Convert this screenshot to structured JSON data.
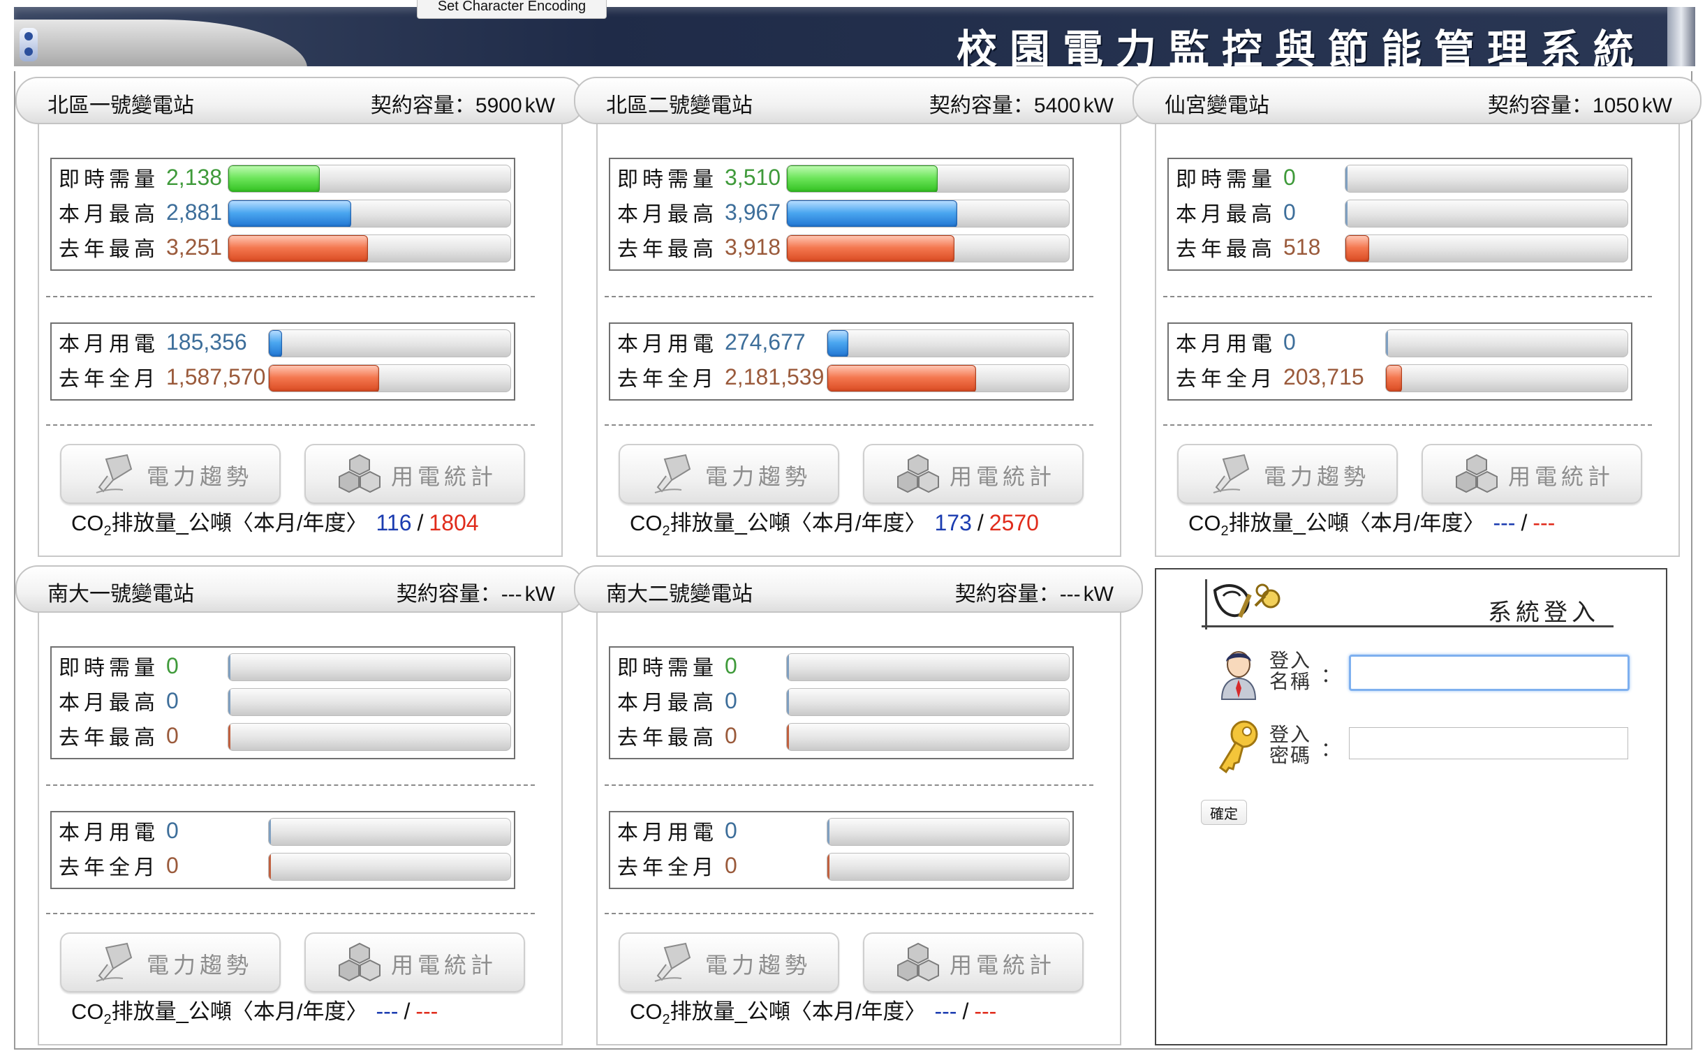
{
  "header": {
    "title": "校園電力監控與節能管理系統",
    "encoding_menu": "Set Character Encoding"
  },
  "labels": {
    "demand_now": "即時需量",
    "month_max": "本月最高",
    "last_year_max": "去年最高",
    "month_usage": "本月用電",
    "last_year_month": "去年全月",
    "capacity_prefix": "契約容量：",
    "capacity_unit": "kW",
    "trend_button": "電力趨勢",
    "stats_button": "用電統計",
    "co2_pre": "CO",
    "co2_sub": "2",
    "co2_post": "排放量_公噸〈本月/年度〉",
    "slash": "/"
  },
  "colors": {
    "demand_now": "#6de55b",
    "month_max": "#4aa6f0",
    "last_year": "#f4774f",
    "co2_month": "#1b3cb0",
    "co2_year": "#e02b1b"
  },
  "stations": [
    {
      "name": "北區一號變電站",
      "capacity": "5900",
      "demand_now": "2,138",
      "month_max": "2,881",
      "last_year_max": "3,251",
      "demand_levels": [
        0.32,
        0.43,
        0.49
      ],
      "month_usage": "185,356",
      "last_year_month": "1,587,570",
      "usage_levels": [
        0.05,
        0.45
      ],
      "co2_month": "116",
      "co2_year": "1804"
    },
    {
      "name": "北區二號變電站",
      "capacity": "5400",
      "demand_now": "3,510",
      "month_max": "3,967",
      "last_year_max": "3,918",
      "demand_levels": [
        0.53,
        0.6,
        0.59
      ],
      "month_usage": "274,677",
      "last_year_month": "2,181,539",
      "usage_levels": [
        0.08,
        0.61
      ],
      "co2_month": "173",
      "co2_year": "2570"
    },
    {
      "name": "仙宮變電站",
      "capacity": "1050",
      "demand_now": "0",
      "month_max": "0",
      "last_year_max": "518",
      "demand_levels": [
        0,
        0,
        0.08
      ],
      "month_usage": "0",
      "last_year_month": "203,715",
      "usage_levels": [
        0,
        0.06
      ],
      "co2_month": "---",
      "co2_year": "---"
    },
    {
      "name": "南大一號變電站",
      "capacity": "---",
      "demand_now": "0",
      "month_max": "0",
      "last_year_max": "0",
      "demand_levels": [
        0,
        0,
        0
      ],
      "month_usage": "0",
      "last_year_month": "0",
      "usage_levels": [
        0,
        0
      ],
      "co2_month": "---",
      "co2_year": "---"
    },
    {
      "name": "南大二號變電站",
      "capacity": "---",
      "demand_now": "0",
      "month_max": "0",
      "last_year_max": "0",
      "demand_levels": [
        0,
        0,
        0
      ],
      "month_usage": "0",
      "last_year_month": "0",
      "usage_levels": [
        0,
        0
      ],
      "co2_month": "---",
      "co2_year": "---"
    }
  ],
  "login": {
    "title": "系統登入",
    "username_label_1": "登入",
    "username_label_2": "名稱",
    "password_label_1": "登入",
    "password_label_2": "密碼",
    "colon": "：",
    "username_value": "",
    "password_value": "",
    "confirm_label": "確定"
  }
}
